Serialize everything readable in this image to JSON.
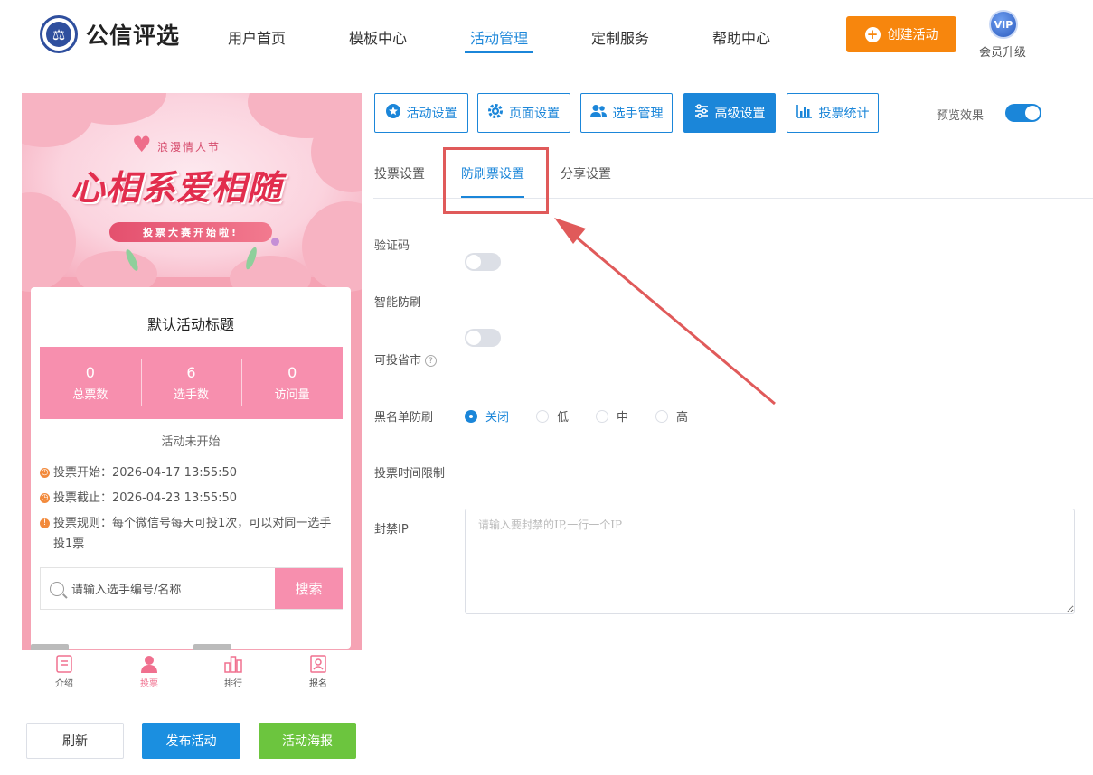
{
  "header": {
    "logo_text": "公信评选",
    "nav": [
      "用户首页",
      "模板中心",
      "活动管理",
      "定制服务",
      "帮助中心"
    ],
    "create_button": "创建活动",
    "vip_badge": "VIP",
    "vip_label": "会员升级"
  },
  "preview": {
    "banner_subtitle": "浪漫情人节",
    "banner_title": "心相系爱相随",
    "banner_pill": "投票大赛开始啦!",
    "card_title": "默认活动标题",
    "stats": [
      {
        "value": "0",
        "label": "总票数"
      },
      {
        "value": "6",
        "label": "选手数"
      },
      {
        "value": "0",
        "label": "访问量"
      }
    ],
    "status": "活动未开始",
    "vote_start": "投票开始：2026-04-17 13:55:50",
    "vote_end": "投票截止：2026-04-23 13:55:50",
    "vote_rules": "投票规则：每个微信号每天可投1次，可以对同一选手投1票",
    "search_placeholder": "请输入选手编号/名称",
    "search_button": "搜索",
    "tabs": [
      "介绍",
      "投票",
      "排行",
      "报名"
    ],
    "active_tab": "投票"
  },
  "actions": {
    "refresh": "刷新",
    "publish": "发布活动",
    "poster": "活动海报"
  },
  "toolbar": {
    "buttons": [
      {
        "label": "活动设置",
        "icon": "star-icon"
      },
      {
        "label": "页面设置",
        "icon": "gear-icon"
      },
      {
        "label": "选手管理",
        "icon": "users-icon"
      },
      {
        "label": "高级设置",
        "icon": "sliders-icon"
      },
      {
        "label": "投票统计",
        "icon": "bar-chart-icon"
      }
    ],
    "active": "高级设置",
    "preview_label": "预览效果",
    "preview_on": true
  },
  "subtabs": [
    "投票设置",
    "防刷票设置",
    "分享设置"
  ],
  "active_subtab": "防刷票设置",
  "form": {
    "captcha_label": "验证码",
    "smart_label": "智能防刷",
    "region_label": "可投省市",
    "region_help": "?",
    "blacklist_label": "黑名单防刷",
    "blacklist_options": [
      "关闭",
      "低",
      "中",
      "高"
    ],
    "blacklist_selected": "关闭",
    "time_limit_label": "投票时间限制",
    "block_ip_label": "封禁IP",
    "block_ip_placeholder": "请输入要封禁的IP,一行一个IP"
  },
  "colors": {
    "primary": "#1b86d9",
    "orange": "#f7860d",
    "pink": "#f78fae",
    "green": "#6cc53e",
    "annotation_red": "#e05a5a"
  }
}
